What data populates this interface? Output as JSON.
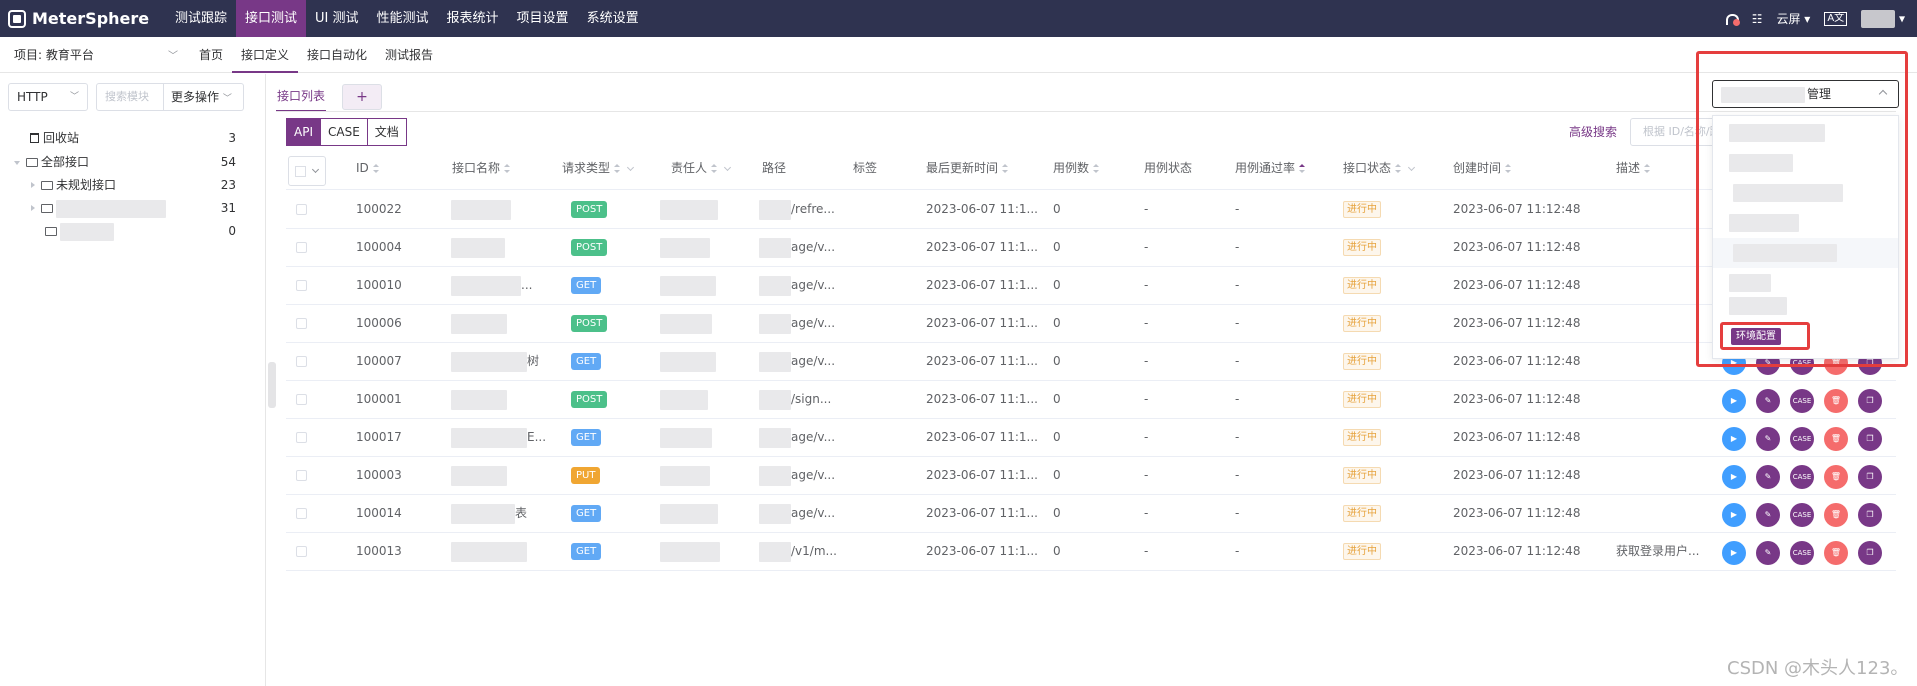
{
  "app": {
    "name": "MeterSphere"
  },
  "nav": {
    "items": [
      "测试跟踪",
      "接口测试",
      "UI 测试",
      "性能测试",
      "报表统计",
      "项目设置",
      "系统设置"
    ],
    "active_index": 1,
    "right": {
      "tasks_label": "☷",
      "workspace": "云屏",
      "lang": "A文"
    }
  },
  "subbar": {
    "project": "项目: 教育平台",
    "tabs": [
      "首页",
      "接口定义",
      "接口自动化",
      "测试报告"
    ],
    "active_index": 1
  },
  "left": {
    "protocol": "HTTP",
    "search_placeholder": "搜索模块",
    "more_ops": "更多操作",
    "tree": [
      {
        "label": "回收站",
        "count": "3"
      },
      {
        "label": "全部接口",
        "count": "54"
      },
      {
        "label": "未规划接口",
        "count": "23"
      },
      {
        "label": "",
        "count": "31"
      },
      {
        "label": "",
        "count": "0"
      }
    ]
  },
  "main": {
    "tab_list": "接口列表",
    "tab_add": "+",
    "segments": [
      "API",
      "CASE",
      "文档"
    ],
    "advanced_search": "高级搜索",
    "id_search_placeholder": "根据 ID/名称/路径搜索",
    "columns": [
      "ID",
      "接口名称",
      "请求类型",
      "责任人",
      "路径",
      "标签",
      "最后更新时间",
      "用例数",
      "用例状态",
      "用例通过率",
      "接口状态",
      "创建时间",
      "描述"
    ],
    "rows": [
      {
        "id": "100022",
        "name_tail": "",
        "method": "POST",
        "path": "/refre...",
        "updated": "2023-06-07 11:1...",
        "cases": "0",
        "case_status": "-",
        "pass_rate": "-",
        "status": "进行中",
        "created": "2023-06-07 11:12:48",
        "desc": ""
      },
      {
        "id": "100004",
        "name_tail": "",
        "method": "POST",
        "path": "age/v...",
        "updated": "2023-06-07 11:1...",
        "cases": "0",
        "case_status": "-",
        "pass_rate": "-",
        "status": "进行中",
        "created": "2023-06-07 11:12:48",
        "desc": ""
      },
      {
        "id": "100010",
        "name_tail": "...",
        "method": "GET",
        "path": "age/v...",
        "updated": "2023-06-07 11:1...",
        "cases": "0",
        "case_status": "-",
        "pass_rate": "-",
        "status": "进行中",
        "created": "2023-06-07 11:12:48",
        "desc": ""
      },
      {
        "id": "100006",
        "name_tail": "",
        "method": "POST",
        "path": "age/v...",
        "updated": "2023-06-07 11:1...",
        "cases": "0",
        "case_status": "-",
        "pass_rate": "-",
        "status": "进行中",
        "created": "2023-06-07 11:12:48",
        "desc": ""
      },
      {
        "id": "100007",
        "name_tail": "树",
        "method": "GET",
        "path": "age/v...",
        "updated": "2023-06-07 11:1...",
        "cases": "0",
        "case_status": "-",
        "pass_rate": "-",
        "status": "进行中",
        "created": "2023-06-07 11:12:48",
        "desc": ""
      },
      {
        "id": "100001",
        "name_tail": "",
        "method": "POST",
        "path": "/sign...",
        "updated": "2023-06-07 11:1...",
        "cases": "0",
        "case_status": "-",
        "pass_rate": "-",
        "status": "进行中",
        "created": "2023-06-07 11:12:48",
        "desc": ""
      },
      {
        "id": "100017",
        "name_tail": "E...",
        "method": "GET",
        "path": "age/v...",
        "updated": "2023-06-07 11:1...",
        "cases": "0",
        "case_status": "-",
        "pass_rate": "-",
        "status": "进行中",
        "created": "2023-06-07 11:12:48",
        "desc": ""
      },
      {
        "id": "100003",
        "name_tail": "",
        "method": "PUT",
        "path": "age/v...",
        "updated": "2023-06-07 11:1...",
        "cases": "0",
        "case_status": "-",
        "pass_rate": "-",
        "status": "进行中",
        "created": "2023-06-07 11:12:48",
        "desc": ""
      },
      {
        "id": "100014",
        "name_tail": "表",
        "method": "GET",
        "path": "age/v...",
        "updated": "2023-06-07 11:1...",
        "cases": "0",
        "case_status": "-",
        "pass_rate": "-",
        "status": "进行中",
        "created": "2023-06-07 11:12:48",
        "desc": ""
      },
      {
        "id": "100013",
        "name_tail": "",
        "method": "GET",
        "path": "/v1/m...",
        "updated": "2023-06-07 11:1...",
        "cases": "0",
        "case_status": "-",
        "pass_rate": "-",
        "status": "进行中",
        "created": "2023-06-07 11:12:48",
        "desc": "获取登录用户..."
      }
    ],
    "ops": {
      "case": "CASE"
    }
  },
  "env": {
    "selected_suffix": "管理",
    "config_button": "环境配置"
  },
  "watermark": "CSDN @木头人123。",
  "colors": {
    "nav_bg": "#2f3350",
    "accent": "#783887",
    "highlight": "#e53e3e"
  }
}
